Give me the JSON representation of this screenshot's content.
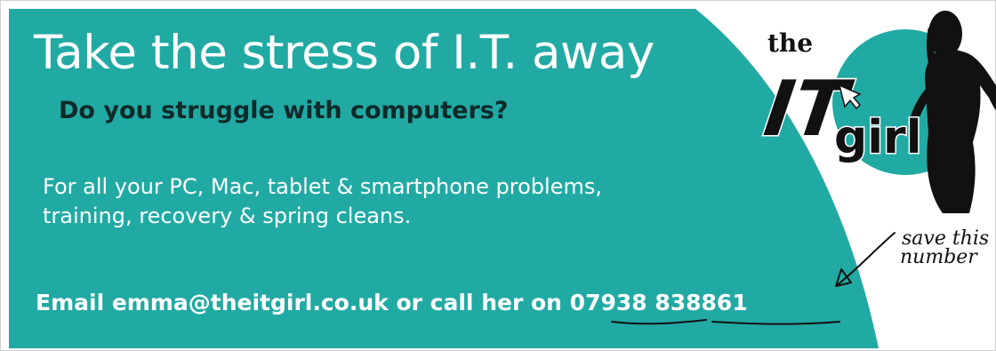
{
  "colors": {
    "teal": "#21aaa3",
    "white": "#ffffff",
    "dark": "#0e2a2a",
    "ink": "#111111"
  },
  "headline": "Take the stress of I.T. away",
  "subheadline": "Do you struggle with computers?",
  "body_line_1": "For all your PC, Mac, tablet & smartphone problems,",
  "body_line_2": "training, recovery & spring cleans.",
  "contact_line": "Email emma@theitgirl.co.uk or call her on 07938 838861",
  "logo": {
    "the": "the",
    "it": "IT",
    "girl": "girl",
    "figure": "woman-silhouette-icon"
  },
  "handwritten_note": {
    "line1": "save this",
    "line2": "number",
    "arrow": "arrow-icon"
  }
}
